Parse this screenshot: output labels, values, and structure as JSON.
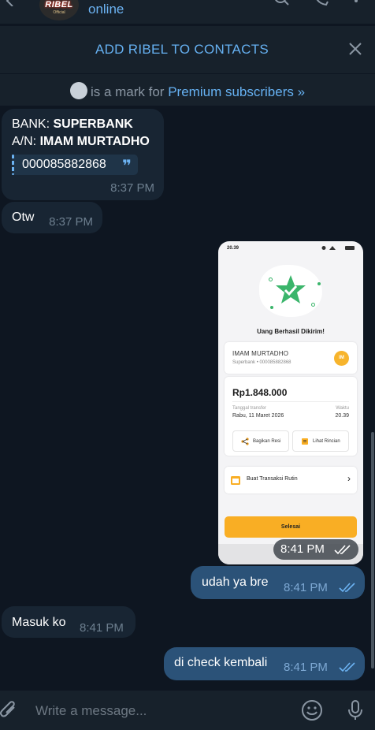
{
  "header": {
    "avatar_text": "RIBEL",
    "avatar_sub": "Official",
    "status": "online"
  },
  "add_contacts": {
    "label": "ADD RIBEL TO CONTACTS"
  },
  "premium": {
    "text": "is a mark for",
    "link": "Premium subscribers »"
  },
  "messages": [
    {
      "bank_label": "BANK:",
      "bank_value": "SUPERBANK",
      "an_label": "A/N:",
      "an_value": "IMAM MURTADHO",
      "account_number": "000085882868",
      "time": "8:37 PM"
    },
    {
      "text": "Otw",
      "time": "8:37 PM"
    },
    {
      "time": "8:41 PM"
    },
    {
      "text": "udah ya bre",
      "time": "8:41 PM"
    },
    {
      "text": "Masuk ko",
      "time": "8:41 PM"
    },
    {
      "text": "di check kembali",
      "time": "8:41 PM"
    }
  ],
  "receipt": {
    "status_time": "20.39",
    "title": "Uang Berhasil Dikirim!",
    "recipient_name": "IMAM MURTADHO",
    "recipient_bank": "Superbank • 000085882868",
    "initials": "IM",
    "amount": "Rp1.848.000",
    "date_label": "Tanggal transfer",
    "date_value": "Rabu, 11 Maret 2026",
    "time_label": "Waktu",
    "time_value": "20.39",
    "share_label": "Bagikan Resi",
    "detail_label": "Lihat Rincian",
    "routine_label": "Buat Transaksi Rutin",
    "done_label": "Selesai",
    "accent": "#f9ae24",
    "star_color": "#3bb56b"
  },
  "composer": {
    "placeholder": "Write a message..."
  },
  "colors": {
    "background": "#0e1621",
    "panel": "#17212b",
    "incoming": "#182533",
    "outgoing": "#2b5278",
    "link": "#66b1f2"
  },
  "icons": [
    "back-icon",
    "search-icon",
    "call-icon",
    "more-icon",
    "close-icon",
    "quote-icon",
    "double-check-icon",
    "attach-icon",
    "emoji-icon",
    "mic-icon"
  ]
}
